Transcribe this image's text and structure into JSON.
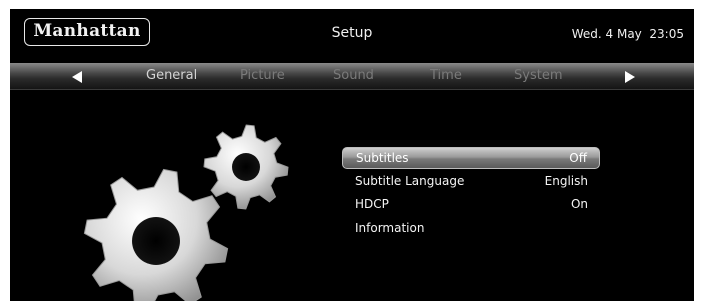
{
  "header": {
    "logo_text": "Manhattan",
    "title": "Setup",
    "datetime": "Wed. 4 May  23:05"
  },
  "tabs": [
    {
      "label": "General",
      "active": true
    },
    {
      "label": "Picture",
      "active": false
    },
    {
      "label": "Sound",
      "active": false
    },
    {
      "label": "Time",
      "active": false
    },
    {
      "label": "System",
      "active": false
    }
  ],
  "icons": {
    "prev": "left-triangle-arrow-icon",
    "next": "right-triangle-arrow-icon",
    "illustration": "gears-icon"
  },
  "menu": {
    "items": [
      {
        "label": "Subtitles",
        "value": "Off",
        "selected": true
      },
      {
        "label": "Subtitle Language",
        "value": "English",
        "selected": false
      },
      {
        "label": "HDCP",
        "value": "On",
        "selected": false
      },
      {
        "label": "Information",
        "value": "",
        "selected": false
      }
    ]
  },
  "colors": {
    "background": "#000000",
    "text": "#f4f4f4",
    "tab_inactive": "#7a7a7a",
    "tab_active": "#d4d4d4"
  }
}
